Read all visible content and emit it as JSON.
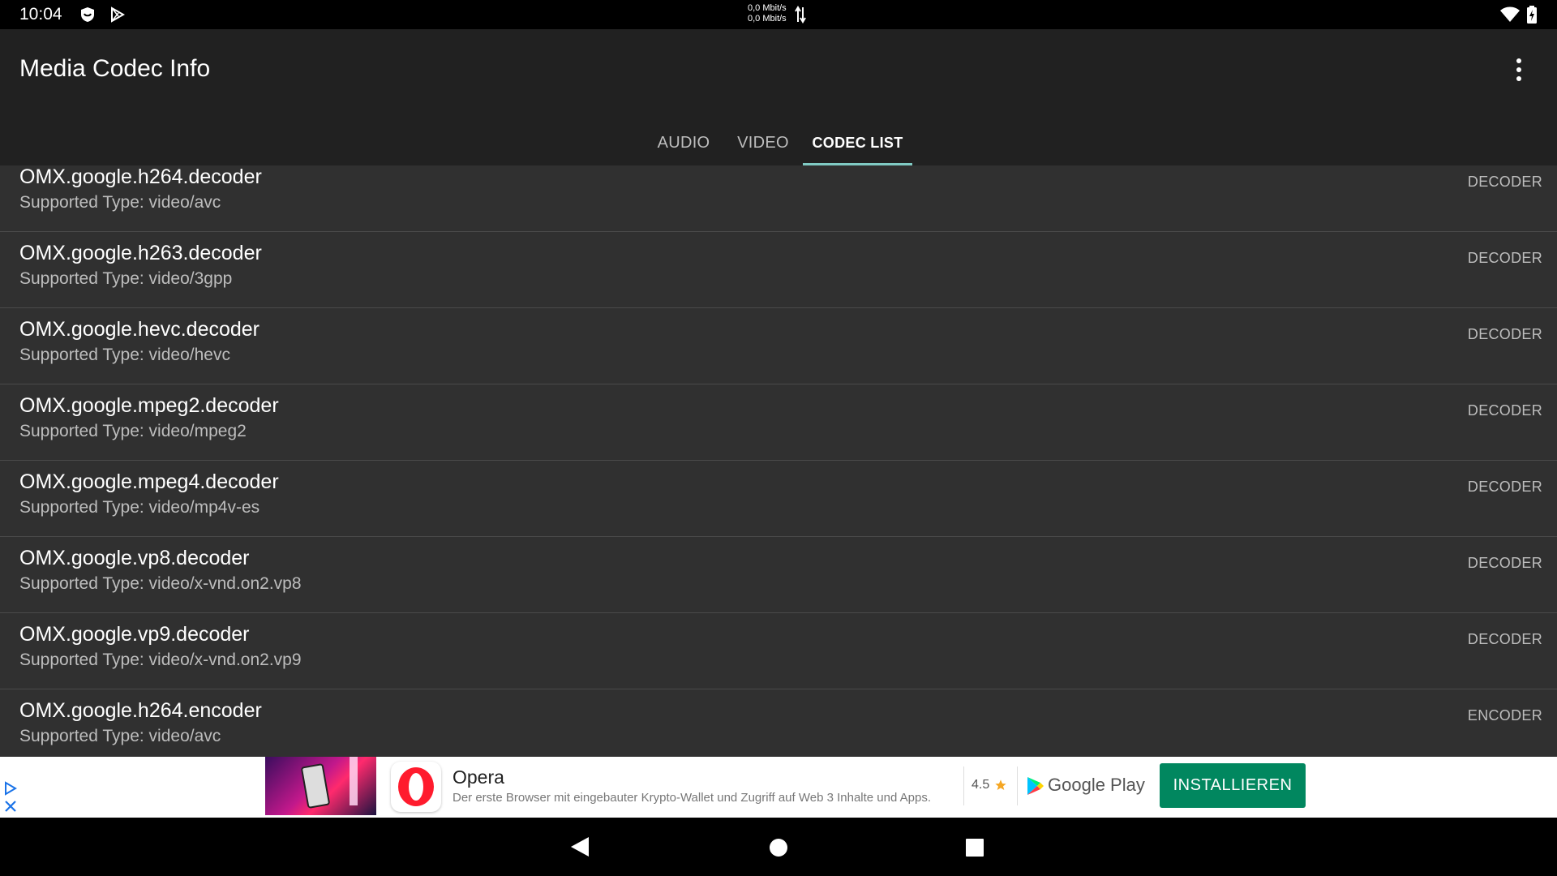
{
  "status_bar": {
    "time": "10:04",
    "net_up": "0,0 Mbit/s",
    "net_down": "0,0 Mbit/s"
  },
  "app_bar": {
    "title": "Media Codec Info",
    "tabs": [
      {
        "label": "AUDIO",
        "active": false
      },
      {
        "label": "VIDEO",
        "active": false
      },
      {
        "label": "CODEC LIST",
        "active": true
      }
    ]
  },
  "codecs": [
    {
      "name": "OMX.google.h264.decoder",
      "type": "Supported Type: video/avc",
      "kind": "DECODER"
    },
    {
      "name": "OMX.google.h263.decoder",
      "type": "Supported Type: video/3gpp",
      "kind": "DECODER"
    },
    {
      "name": "OMX.google.hevc.decoder",
      "type": "Supported Type: video/hevc",
      "kind": "DECODER"
    },
    {
      "name": "OMX.google.mpeg2.decoder",
      "type": "Supported Type: video/mpeg2",
      "kind": "DECODER"
    },
    {
      "name": "OMX.google.mpeg4.decoder",
      "type": "Supported Type: video/mp4v-es",
      "kind": "DECODER"
    },
    {
      "name": "OMX.google.vp8.decoder",
      "type": "Supported Type: video/x-vnd.on2.vp8",
      "kind": "DECODER"
    },
    {
      "name": "OMX.google.vp9.decoder",
      "type": "Supported Type: video/x-vnd.on2.vp9",
      "kind": "DECODER"
    },
    {
      "name": "OMX.google.h264.encoder",
      "type": "Supported Type: video/avc",
      "kind": "ENCODER"
    }
  ],
  "ad": {
    "app_name": "Opera",
    "description": "Der erste Browser mit eingebauter Krypto-Wallet und Zugriff auf Web 3 Inhalte und Apps.",
    "rating": "4.5",
    "store": "Google Play",
    "cta": "INSTALLIEREN"
  },
  "colors": {
    "app_bar": "#212121",
    "list_bg": "#303030",
    "tab_indicator": "#80cbc4",
    "install_button": "#01875f"
  }
}
